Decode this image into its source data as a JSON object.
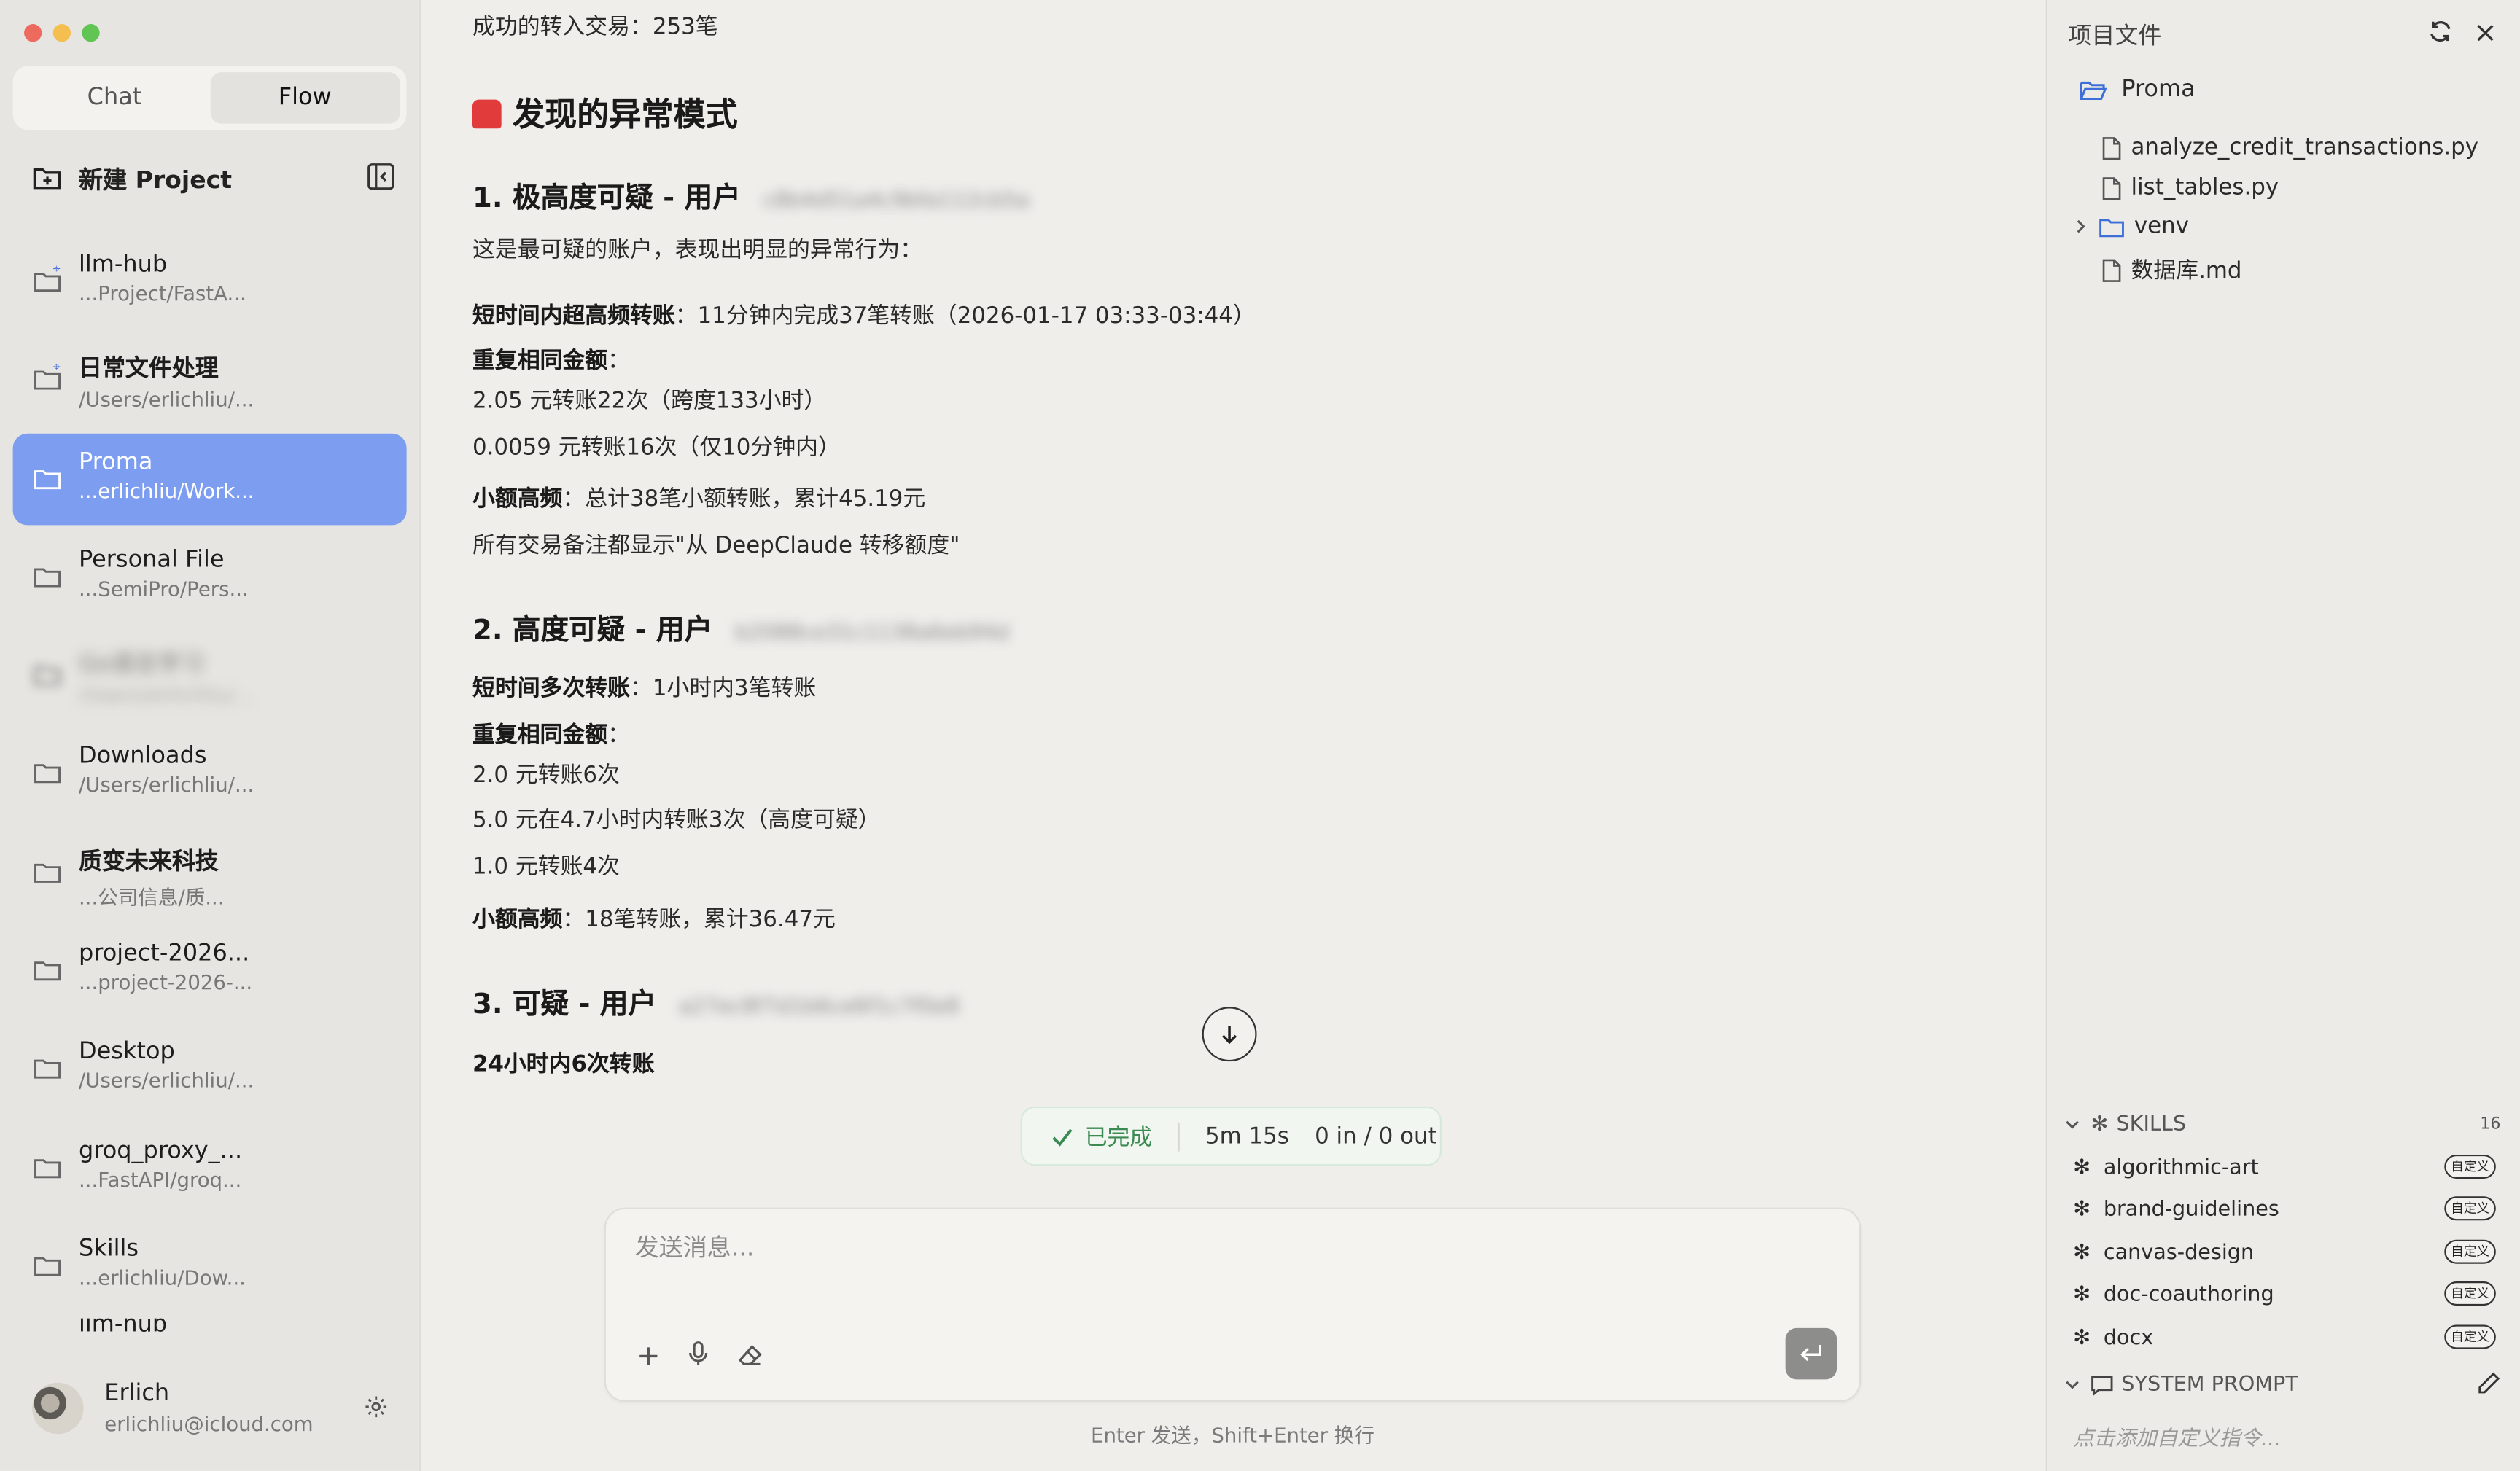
{
  "sidebar": {
    "tabs": [
      {
        "label": "Chat"
      },
      {
        "label": "Flow"
      }
    ],
    "new_project_label": "新建 Project",
    "projects": [
      {
        "name": "llm-hub",
        "path": "...Project/FastA..."
      },
      {
        "name": "日常文件处理",
        "path": "/Users/erlichliu/..."
      },
      {
        "name": "Proma",
        "path": "...erlichliu/Work..."
      },
      {
        "name": "Personal File",
        "path": "...SemiPro/Pers..."
      },
      {
        "name": "Go语言学习",
        "path": "/Users/erlichliu/..."
      },
      {
        "name": "Downloads",
        "path": "/Users/erlichliu/..."
      },
      {
        "name": "质变未来科技",
        "path": "...公司信息/质..."
      },
      {
        "name": "project-2026...",
        "path": "...project-2026-..."
      },
      {
        "name": "Desktop",
        "path": "/Users/erlichliu/..."
      },
      {
        "name": "groq_proxy_...",
        "path": "...FastAPI/groq..."
      },
      {
        "name": "Skills",
        "path": "...erlichliu/Dow..."
      },
      {
        "name": "llm-hub",
        "path": ""
      }
    ],
    "user": {
      "name": "Erlich",
      "email": "erlichliu@icloud.com"
    }
  },
  "main": {
    "top_line": "成功的转入交易：253笔",
    "section_title": "发现的异常模式",
    "items": {
      "h1": "1. 极高度可疑 - 用户",
      "h1_id": "c8b4d51a4c9bfa112cb5a",
      "intro": "这是最可疑的账户，表现出明显的异常行为：",
      "p1_label": "短时间内超高频转账",
      "p1_text": "：11分钟内完成37笔转账（2026-01-17 03:33-03:44）",
      "p2_label": "重复相同金额",
      "p2_colon": "：",
      "p2_a": "2.05 元转账22次（跨度133小时）",
      "p2_b": "0.0059 元转账16次（仅10分钟内）",
      "p3_label": "小额高频",
      "p3_text": "：总计38笔小额转账，累计45.19元",
      "p3_note": "所有交易备注都显示\"从 DeepClaude 转移额度\"",
      "h2": "2. 高度可疑 - 用户",
      "h2_id": "b2088ce31c1138a6eb94d",
      "q1_label": "短时间多次转账",
      "q1_text": "：1小时内3笔转账",
      "q2_label": "重复相同金额",
      "q2_colon": "：",
      "q2_a": "2.0 元转账6次",
      "q2_b": "5.0 元在4.7小时内转账3次（高度可疑）",
      "q2_c": "1.0 元转账4次",
      "q3_label": "小额高频",
      "q3_text": "：18笔转账，累计36.47元",
      "h3": "3. 可疑 - 用户",
      "h3_id": "a27ec8f7d1b6ce6f1c7f0e8",
      "r1": "24小时内6次转账"
    },
    "status": {
      "done": "已完成",
      "duration": "5m 15s",
      "tokens": "0 in / 0 out"
    },
    "composer": {
      "placeholder": "发送消息...",
      "hint": "Enter 发送，Shift+Enter 换行"
    }
  },
  "right_panel": {
    "title": "项目文件",
    "root": "Proma",
    "files": [
      {
        "name": "analyze_credit_transactions.py",
        "kind": "file"
      },
      {
        "name": "list_tables.py",
        "kind": "file"
      },
      {
        "name": "venv",
        "kind": "folder"
      },
      {
        "name": "数据库.md",
        "kind": "file"
      }
    ],
    "skills_label": "SKILLS",
    "skills_count": "16",
    "skills": [
      {
        "name": "algorithmic-art",
        "tag": "自定义"
      },
      {
        "name": "brand-guidelines",
        "tag": "自定义"
      },
      {
        "name": "canvas-design",
        "tag": "自定义"
      },
      {
        "name": "doc-coauthoring",
        "tag": "自定义"
      },
      {
        "name": "docx",
        "tag": "自定义"
      }
    ],
    "system_prompt_label": "SYSTEM PROMPT",
    "system_prompt_hint": "点击添加自定义指令..."
  },
  "colors": {
    "accent": "#7d9ef0",
    "success": "#3a8a52",
    "folder_blue": "#3e6fd8"
  }
}
